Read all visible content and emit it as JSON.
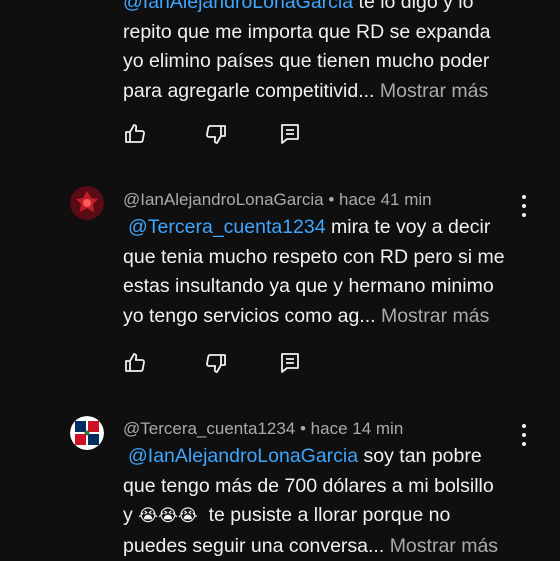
{
  "comments": [
    {
      "handle": "",
      "mention": "@IanAlejandroLonaGarcia",
      "text_after_mention": " te lo digo y lo",
      "lines": [
        "repito que me importa que RD se expanda",
        "yo elimino países que tienen mucho poder",
        "para agregarle competitivid..."
      ],
      "more": "Mostrar más"
    },
    {
      "handle": "@IanAlejandroLonaGarcia",
      "time": "hace 41 min",
      "mention": "@Tercera_cuenta1234",
      "text_after_mention": " mira te voy a decir",
      "lines": [
        "que tenia mucho respeto con RD pero si me",
        "estas insultando ya que y hermano minimo",
        "yo tengo servicios como ag..."
      ],
      "more": "Mostrar más"
    },
    {
      "handle": "@Tercera_cuenta1234",
      "time": "hace 14 min",
      "mention": "@IanAlejandroLonaGarcia",
      "text_after_mention": " soy tan pobre",
      "lines": [
        "que tengo más de 700 dólares a mi bolsillo",
        "y",
        "te pusiste a llorar porque no",
        "puedes seguir una conversa..."
      ],
      "emojis": "😭😭😭",
      "more": "Mostrar más"
    }
  ],
  "meta_separator": " • ",
  "icons": [
    "thumb-up-icon",
    "thumb-down-icon",
    "reply-icon",
    "more-vert-icon"
  ],
  "colors": {
    "background": "#0f0f0f",
    "text": "#f1f1f1",
    "secondary": "#aaaaaa",
    "mention": "#3ea6ff"
  }
}
